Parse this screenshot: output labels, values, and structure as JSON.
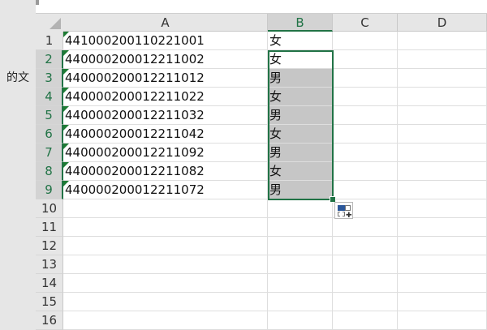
{
  "left_panel_text": "的文",
  "columns": [
    "A",
    "B",
    "C",
    "D"
  ],
  "selected_column": "B",
  "rows": [
    {
      "num": "1",
      "a": "441000200110221001",
      "b": "女"
    },
    {
      "num": "2",
      "a": "440000200012211002",
      "b": "女"
    },
    {
      "num": "3",
      "a": "440000200012211012",
      "b": "男"
    },
    {
      "num": "4",
      "a": "440000200012211022",
      "b": "女"
    },
    {
      "num": "5",
      "a": "440000200012211032",
      "b": "男"
    },
    {
      "num": "6",
      "a": "440000200012211042",
      "b": "女"
    },
    {
      "num": "7",
      "a": "440000200012211092",
      "b": "男"
    },
    {
      "num": "8",
      "a": "440000200012211082",
      "b": "女"
    },
    {
      "num": "9",
      "a": "440000200012211072",
      "b": "男"
    },
    {
      "num": "10",
      "a": "",
      "b": ""
    },
    {
      "num": "11",
      "a": "",
      "b": ""
    },
    {
      "num": "12",
      "a": "",
      "b": ""
    },
    {
      "num": "13",
      "a": "",
      "b": ""
    },
    {
      "num": "14",
      "a": "",
      "b": ""
    },
    {
      "num": "15",
      "a": "",
      "b": ""
    },
    {
      "num": "16",
      "a": "",
      "b": ""
    }
  ],
  "selection_rows": [
    "2",
    "3",
    "4",
    "5",
    "6",
    "7",
    "8",
    "9"
  ],
  "accent_color": "#217346",
  "error_flag_color": "#1e7b34",
  "icons": {
    "quick_analysis": "quick-analysis-icon"
  }
}
